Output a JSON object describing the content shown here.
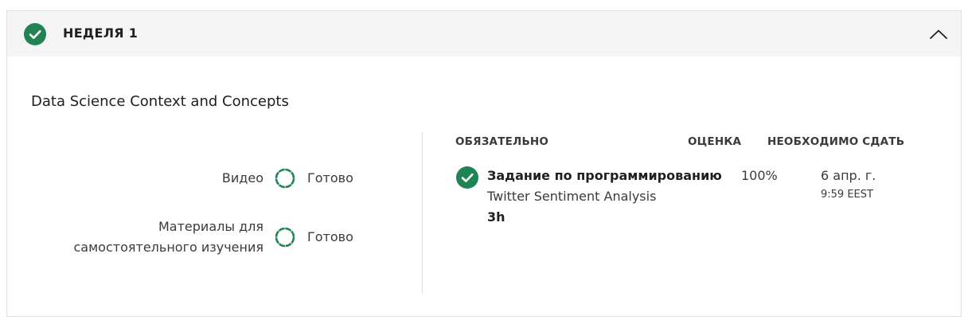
{
  "week": {
    "title": "НЕДЕЛЯ 1",
    "completed": true
  },
  "module": {
    "title": "Data Science Context and Concepts"
  },
  "progress": [
    {
      "label_lines": [
        "Видео"
      ],
      "status": "Готово"
    },
    {
      "label_lines": [
        "Материалы для",
        "самостоятельного изучения"
      ],
      "status": "Готово"
    }
  ],
  "table": {
    "headers": {
      "required": "ОБЯЗАТЕЛЬНО",
      "grade": "ОЦЕНКА",
      "due": "НЕОБХОДИМО СДАТЬ"
    },
    "items": [
      {
        "type": "Задание по программированию",
        "name": "Twitter Sentiment Analysis",
        "duration": "3h",
        "grade": "100%",
        "due_date": "6 апр. г.",
        "due_time": "9:59 EEST",
        "completed": true
      }
    ]
  },
  "colors": {
    "accent": "#1f8354",
    "header_bg": "#f5f5f5",
    "border": "#e1e1e1"
  }
}
